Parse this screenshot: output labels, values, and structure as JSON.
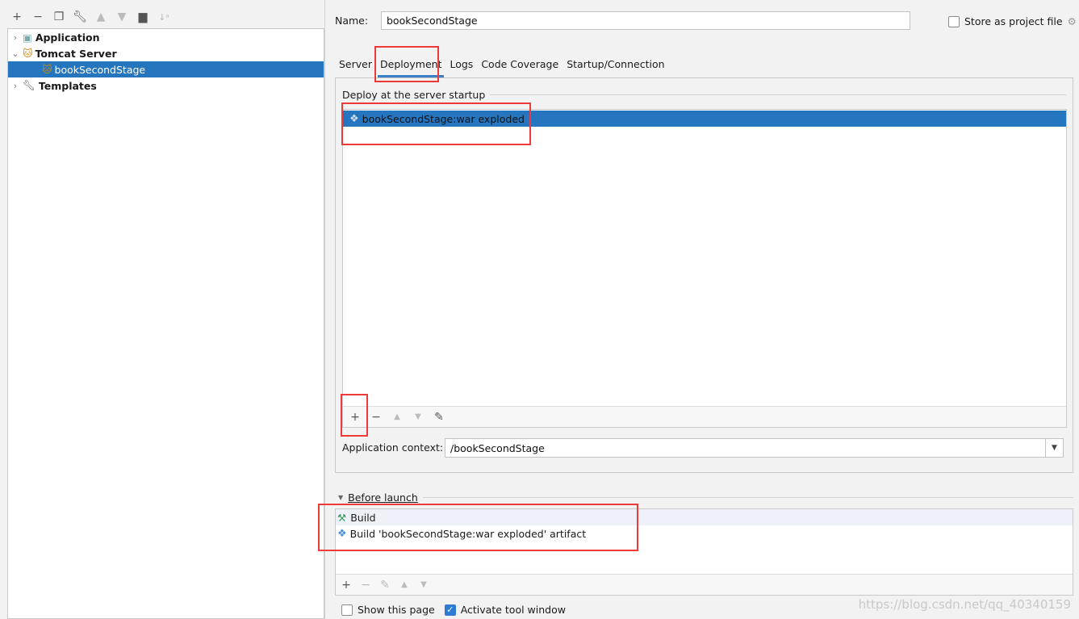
{
  "left_toolbar": {
    "icons": [
      "plus-icon",
      "minus-icon",
      "copy-icon",
      "wrench-icon",
      "arrow-up-icon",
      "arrow-down-icon",
      "new-folder-icon",
      "sort-icon"
    ]
  },
  "tree": [
    {
      "label": "Application",
      "bold": true,
      "expanded": false
    },
    {
      "label": "Tomcat Server",
      "bold": true,
      "expanded": true
    },
    {
      "label": "bookSecondStage",
      "bold": false,
      "selected": true
    },
    {
      "label": "Templates",
      "bold": true,
      "expanded": false
    }
  ],
  "name": {
    "label": "Name:",
    "value": "bookSecondStage"
  },
  "store_project": {
    "label": "Store as project file",
    "checked": false
  },
  "tabs": [
    "Server",
    "Deployment",
    "Logs",
    "Code Coverage",
    "Startup/Connection"
  ],
  "active_tab": "Deployment",
  "deploy": {
    "group_label": "Deploy at the server startup",
    "items": [
      "bookSecondStage:war exploded"
    ]
  },
  "app_context": {
    "label": "Application context:",
    "value": "/bookSecondStage"
  },
  "before_launch": {
    "label": "Before launch",
    "items": [
      "Build",
      "Build 'bookSecondStage:war exploded' artifact"
    ]
  },
  "bottom": {
    "show_page": {
      "label": "Show this page",
      "checked": false
    },
    "activate_tool": {
      "label": "Activate tool window",
      "checked": true
    }
  },
  "watermark": "https://blog.csdn.net/qq_40340159",
  "colors": {
    "selection": "#2675bf",
    "annotation": "#f03a3a"
  }
}
